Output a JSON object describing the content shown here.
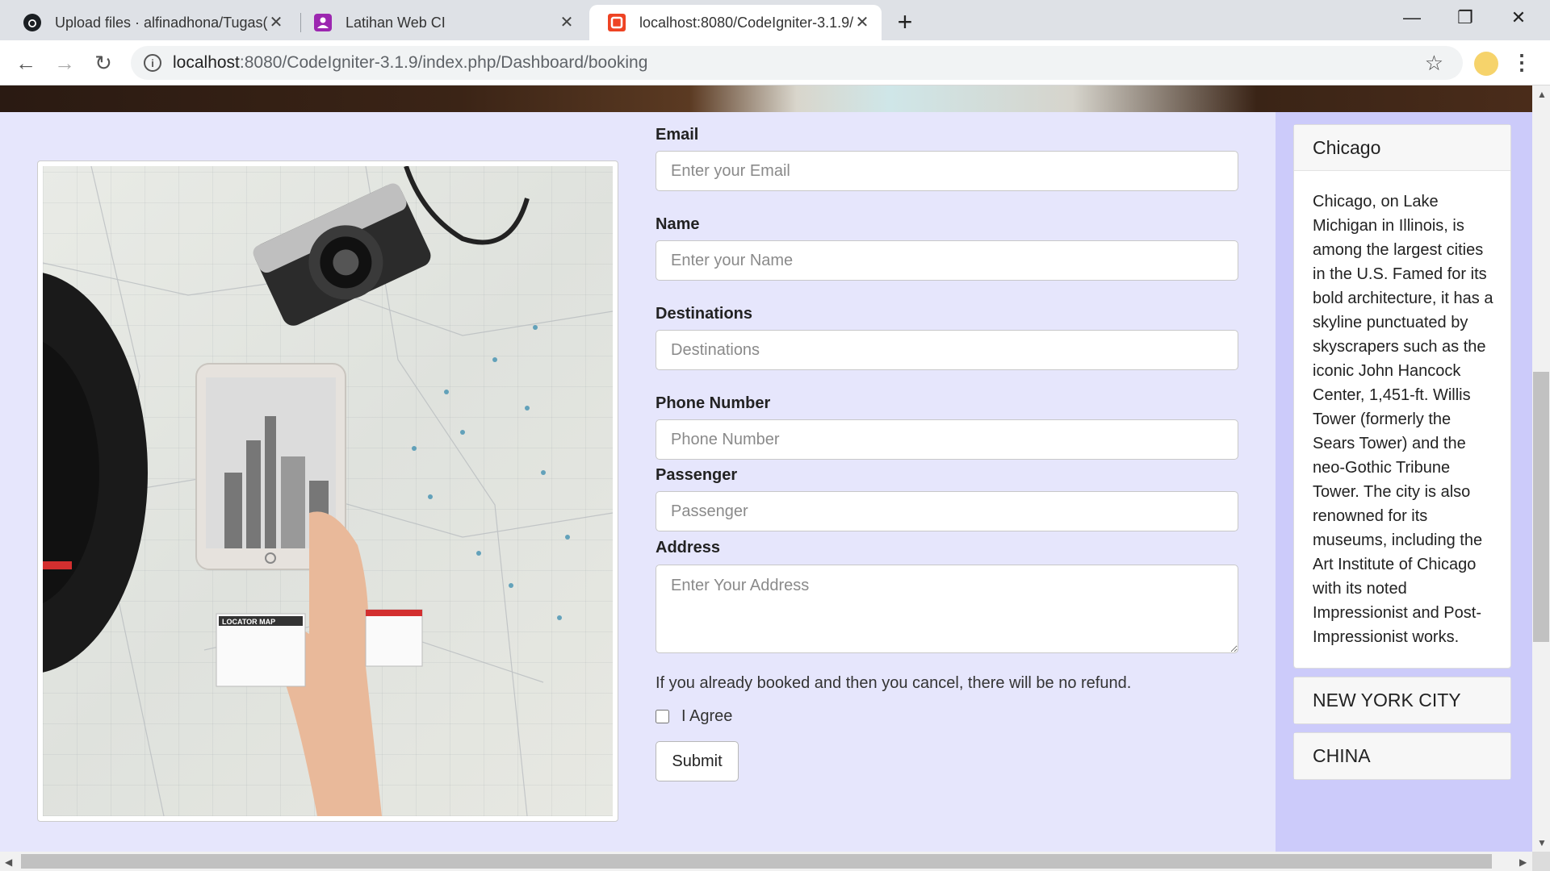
{
  "browser": {
    "tabs": [
      {
        "title": "Upload files · alfinadhona/Tugas(",
        "icon": "github-icon"
      },
      {
        "title": "Latihan Web CI",
        "icon": "classroom-icon"
      },
      {
        "title": "localhost:8080/CodeIgniter-3.1.9/",
        "icon": "codeigniter-icon",
        "active": true
      }
    ],
    "url_host": "localhost",
    "url_rest": ":8080/CodeIgniter-3.1.9/index.php/Dashboard/booking"
  },
  "form": {
    "email": {
      "label": "Email",
      "placeholder": "Enter your Email"
    },
    "name": {
      "label": "Name",
      "placeholder": "Enter your Name"
    },
    "destinations": {
      "label": "Destinations",
      "placeholder": "Destinations"
    },
    "phone": {
      "label": "Phone Number",
      "placeholder": "Phone Number"
    },
    "passenger": {
      "label": "Passenger",
      "placeholder": "Passenger"
    },
    "address": {
      "label": "Address",
      "placeholder": "Enter Your Address"
    },
    "notice": "If you already booked and then you cancel, there will be no refund.",
    "agree_label": "I Agree",
    "submit_label": "Submit"
  },
  "sidebar": {
    "items": [
      {
        "title": "Chicago",
        "body": "Chicago, on Lake Michigan in Illinois, is among the largest cities in the U.S. Famed for its bold architecture, it has a skyline punctuated by skyscrapers such as the iconic John Hancock Center, 1,451-ft. Willis Tower (formerly the Sears Tower) and the neo-Gothic Tribune Tower. The city is also renowned for its museums, including the Art Institute of Chicago with its noted Impressionist and Post-Impressionist works."
      },
      {
        "title": "NEW YORK CITY"
      },
      {
        "title": "CHINA"
      }
    ]
  },
  "photo": {
    "map_tag": "LOCATOR MAP"
  },
  "colors": {
    "page_bg": "#e6e6fc",
    "sidebar_bg": "#cccbfa"
  }
}
